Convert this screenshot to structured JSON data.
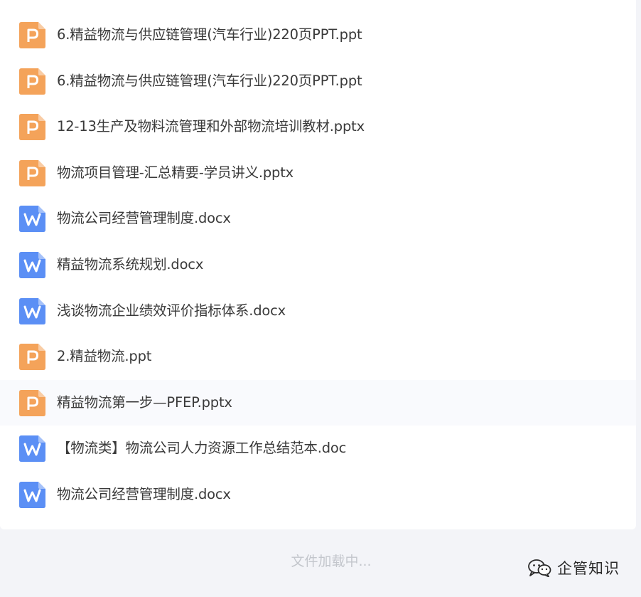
{
  "files": [
    {
      "name": "6.精益物流与供应链管理(汽车行业)220页PPT.ppt",
      "type": "ppt",
      "icon": "ppt-file-icon"
    },
    {
      "name": "6.精益物流与供应链管理(汽车行业)220页PPT.ppt",
      "type": "ppt",
      "icon": "ppt-file-icon"
    },
    {
      "name": "12-13生产及物料流管理和外部物流培训教材.pptx",
      "type": "ppt",
      "icon": "ppt-file-icon"
    },
    {
      "name": "物流项目管理-汇总精要-学员讲义.pptx",
      "type": "ppt",
      "icon": "ppt-file-icon"
    },
    {
      "name": "物流公司经营管理制度.docx",
      "type": "doc",
      "icon": "word-file-icon"
    },
    {
      "name": "精益物流系统规划.docx",
      "type": "doc",
      "icon": "word-file-icon"
    },
    {
      "name": "浅谈物流企业绩效评价指标体系.docx",
      "type": "doc",
      "icon": "word-file-icon"
    },
    {
      "name": "2.精益物流.ppt",
      "type": "ppt",
      "icon": "ppt-file-icon"
    },
    {
      "name": "精益物流第一步—PFEP.pptx",
      "type": "ppt",
      "icon": "ppt-file-icon"
    },
    {
      "name": "【物流类】物流公司人力资源工作总结范本.doc",
      "type": "doc",
      "icon": "word-file-icon"
    },
    {
      "name": "物流公司经营管理制度.docx",
      "type": "doc",
      "icon": "word-file-icon"
    }
  ],
  "loading_text": "文件加载中...",
  "watermark": {
    "text": "企管知识",
    "icon": "wechat-icon"
  },
  "colors": {
    "ppt_icon": "#f4a35a",
    "word_icon": "#5b8ff5",
    "text": "#3a3a3a",
    "loading_text": "#c3c6cc",
    "background": "#f3f4f8",
    "panel": "#ffffff",
    "highlight_row": "#f9fafd"
  }
}
